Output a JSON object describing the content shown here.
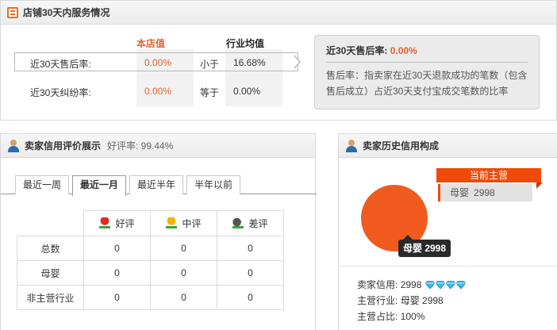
{
  "service": {
    "title": "店铺30天内服务情况",
    "col_store": "本店值",
    "col_avg": "行业均值",
    "rows": [
      {
        "label": "近30天售后率:",
        "store": "0.00%",
        "compare": "小于",
        "avg": "16.68%"
      },
      {
        "label": "近30天纠纷率:",
        "store": "0.00%",
        "compare": "等于",
        "avg": "0.00%"
      }
    ],
    "tip": {
      "title": "近30天售后率:",
      "value": "0.00%",
      "text": "售后率：指卖家在近30天退款成功的笔数（包含售后成立）占近30天支付宝成交笔数的比率"
    }
  },
  "rating": {
    "title": "卖家信用评价展示",
    "subtitle": "好评率: 99.44%",
    "tabs": [
      "最近一周",
      "最近一月",
      "最近半年",
      "半年以前"
    ],
    "active_tab": 1,
    "headers": [
      "好评",
      "中评",
      "差评"
    ],
    "rows": [
      {
        "label": "总数",
        "values": [
          "0",
          "0",
          "0"
        ]
      },
      {
        "label": "母婴",
        "values": [
          "0",
          "0",
          "0"
        ]
      },
      {
        "label": "非主营行业",
        "values": [
          "0",
          "0",
          "0"
        ]
      }
    ]
  },
  "history": {
    "title": "卖家历史信用构成",
    "current_main_label": "当前主营",
    "main_category": "母婴",
    "main_count": "2998",
    "pie_tooltip": "母婴 2998",
    "lines": [
      {
        "label": "卖家信用:",
        "value": "2998"
      },
      {
        "label": "主营行业:",
        "value": "母婴 2998"
      },
      {
        "label": "主营占比:",
        "value": "100%"
      }
    ],
    "diamond_count": 4
  },
  "chart_data": {
    "type": "pie",
    "slices": [
      {
        "label": "母婴",
        "value": 2998
      }
    ]
  },
  "colors": {
    "accent": "#e8602c",
    "pie": "#f05a1e",
    "diamond": "#3fb6e8"
  }
}
